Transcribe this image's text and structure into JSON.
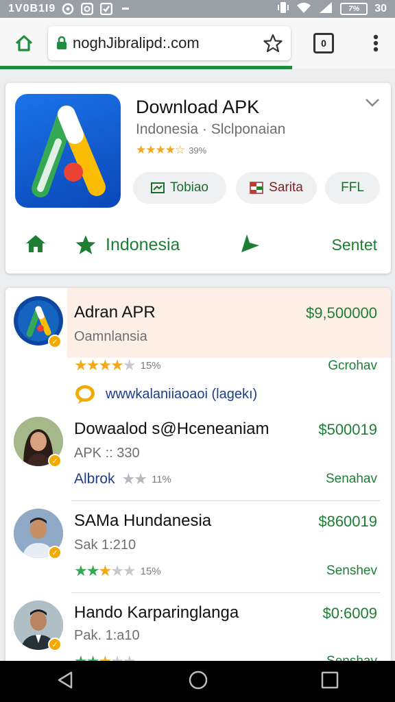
{
  "status_bar": {
    "time": "1V0B1I9",
    "battery": "7%",
    "clock_right": "30"
  },
  "browser": {
    "url": "noghJibralipd:.com",
    "tab_count": "0"
  },
  "app": {
    "title": "Download APK",
    "subtitle": "Indonesia · Slclponaian",
    "rating_count": "39%",
    "chips": [
      {
        "label": "Tobiao",
        "icon": "window-icon"
      },
      {
        "label": "Sarita",
        "icon": "flag-icon"
      },
      {
        "label": "FFL"
      }
    ],
    "actions": {
      "star_label": "Indonesia",
      "right_label": "Sentet"
    },
    "colors": {
      "accent": "#1e7e34",
      "star": "#f0a81c"
    }
  },
  "results": [
    {
      "name": "Adran APR",
      "price": "$9,500000",
      "sub": "Oamnlansia",
      "stars": 4,
      "count": "15%",
      "action": "Gcrohav",
      "link": "wwwkalaniiaoaoi (lagekı)",
      "highlight": true
    },
    {
      "name": "Dowaalod s@Hceneaniam",
      "price": "$500019",
      "sub": "APK :: 330",
      "brand": "Albrok",
      "stars": 2,
      "count": "11%",
      "action": "Senahav"
    },
    {
      "name": "SAMa Hundanesia",
      "price": "$860019",
      "sub": "Sak 1:210",
      "stars": 3,
      "count": "15%",
      "action": "Senshev"
    },
    {
      "name": "Hando Karparinglanga",
      "price": "$0:6009",
      "sub": "Pak. 1:a10",
      "stars": 3,
      "count": "",
      "action": "Senshav"
    }
  ]
}
